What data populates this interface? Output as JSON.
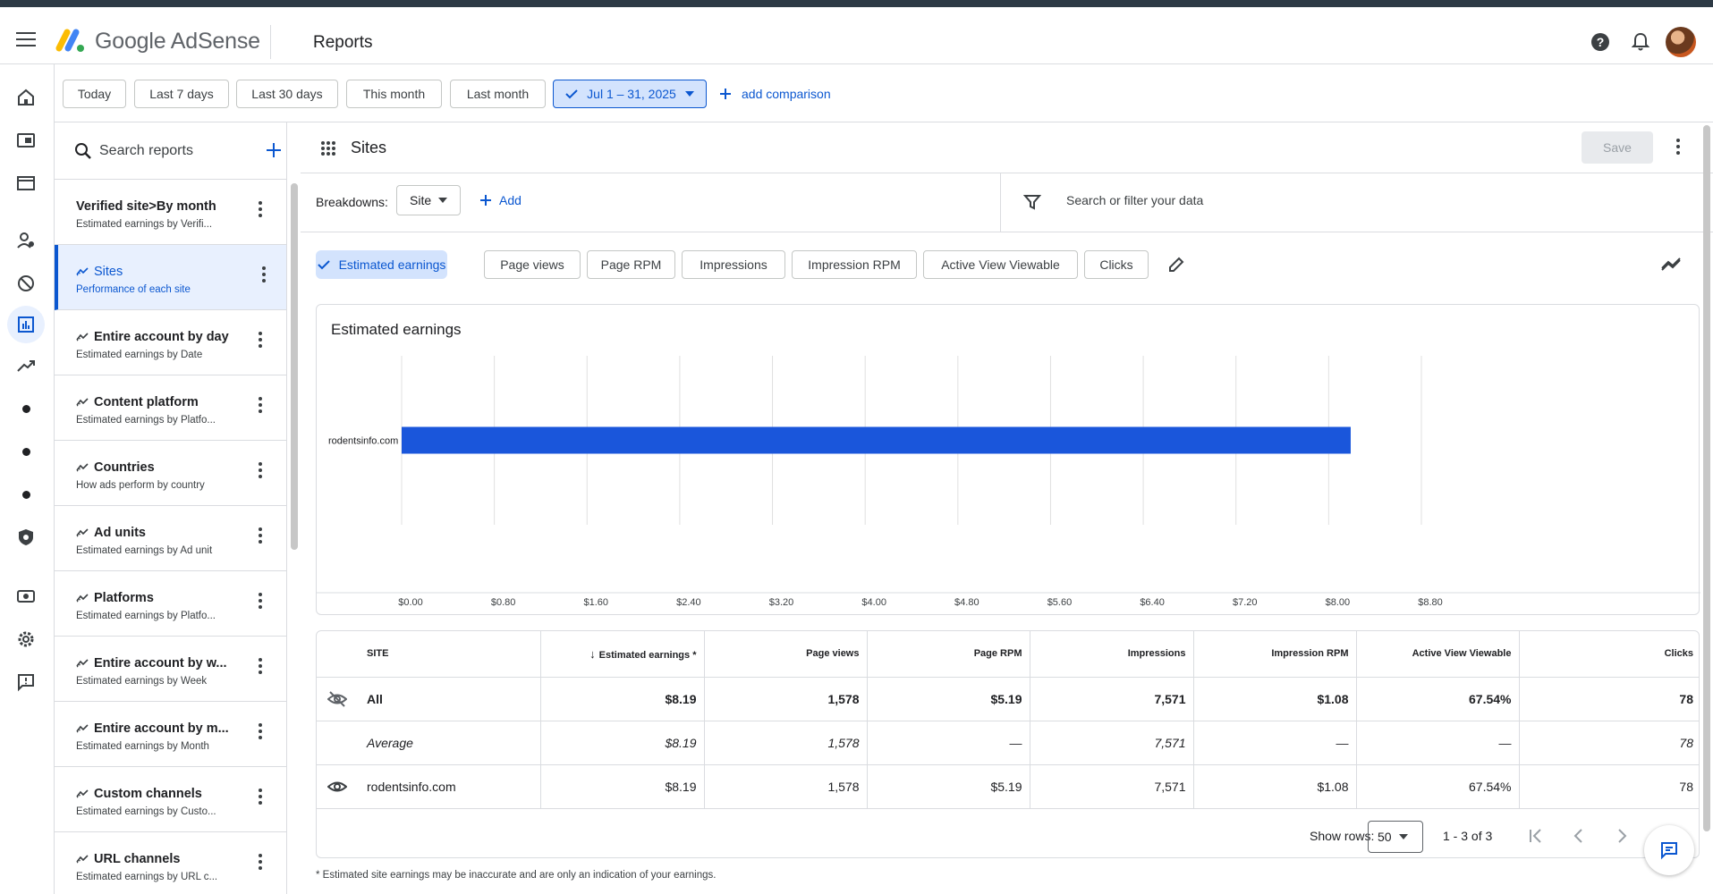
{
  "header": {
    "brand": "Google AdSense",
    "title": "Reports"
  },
  "colors": {
    "accent": "#0b57d0",
    "bar": "#1a56db",
    "selected_bg": "#d3e3fd"
  },
  "date_ranges": [
    "Today",
    "Last 7 days",
    "Last 30 days",
    "This month",
    "Last month"
  ],
  "selected_range": "Jul 1 – 31, 2025",
  "add_comparison": "add comparison",
  "left_panel": {
    "search_placeholder": "Search reports",
    "reports": [
      {
        "title": "Verified site>By month",
        "subtitle": "Estimated earnings by Verifi..."
      },
      {
        "title": "Sites",
        "subtitle": "Performance of each site"
      },
      {
        "title": "Entire account by day",
        "subtitle": "Estimated earnings by Date"
      },
      {
        "title": "Content platform",
        "subtitle": "Estimated earnings by Platfo..."
      },
      {
        "title": "Countries",
        "subtitle": "How ads perform by country"
      },
      {
        "title": "Ad units",
        "subtitle": "Estimated earnings by Ad unit"
      },
      {
        "title": "Platforms",
        "subtitle": "Estimated earnings by Platfo..."
      },
      {
        "title": "Entire account by w...",
        "subtitle": "Estimated earnings by Week"
      },
      {
        "title": "Entire account by m...",
        "subtitle": "Estimated earnings by Month"
      },
      {
        "title": "Custom channels",
        "subtitle": "Estimated earnings by Custo..."
      },
      {
        "title": "URL channels",
        "subtitle": "Estimated earnings by URL c..."
      }
    ]
  },
  "main": {
    "title": "Sites",
    "save_label": "Save",
    "breakdowns_label": "Breakdowns:",
    "breakdown_value": "Site",
    "add_label": "Add",
    "filter_placeholder": "Search or filter your data",
    "metrics": [
      "Estimated earnings",
      "Page views",
      "Page RPM",
      "Impressions",
      "Impression RPM",
      "Active View Viewable",
      "Clicks"
    ]
  },
  "chart_data": {
    "type": "bar",
    "orientation": "horizontal",
    "title": "Estimated earnings",
    "categories": [
      "rodentsinfo.com"
    ],
    "values": [
      8.19
    ],
    "xlim": [
      0,
      8.8
    ],
    "x_ticks": [
      "$0.00",
      "$0.80",
      "$1.60",
      "$2.40",
      "$3.20",
      "$4.00",
      "$4.80",
      "$5.60",
      "$6.40",
      "$7.20",
      "$8.00",
      "$8.80"
    ],
    "grid": true
  },
  "table": {
    "headers": [
      "SITE",
      "Estimated earnings *",
      "Page views",
      "Page RPM",
      "Impressions",
      "Impression RPM",
      "Active View Viewable",
      "Clicks"
    ],
    "rows": [
      [
        "All",
        "$8.19",
        "1,578",
        "$5.19",
        "7,571",
        "$1.08",
        "67.54%",
        "78"
      ],
      [
        "Average",
        "$8.19",
        "1,578",
        "—",
        "7,571",
        "—",
        "—",
        "78"
      ],
      [
        "rodentsinfo.com",
        "$8.19",
        "1,578",
        "$5.19",
        "7,571",
        "$1.08",
        "67.54%",
        "78"
      ]
    ],
    "show_rows_label": "Show rows:",
    "rows_per_page": "50",
    "page_count": "1 - 3 of 3"
  },
  "footnote": "* Estimated site earnings may be inaccurate and are only an indication of your earnings."
}
